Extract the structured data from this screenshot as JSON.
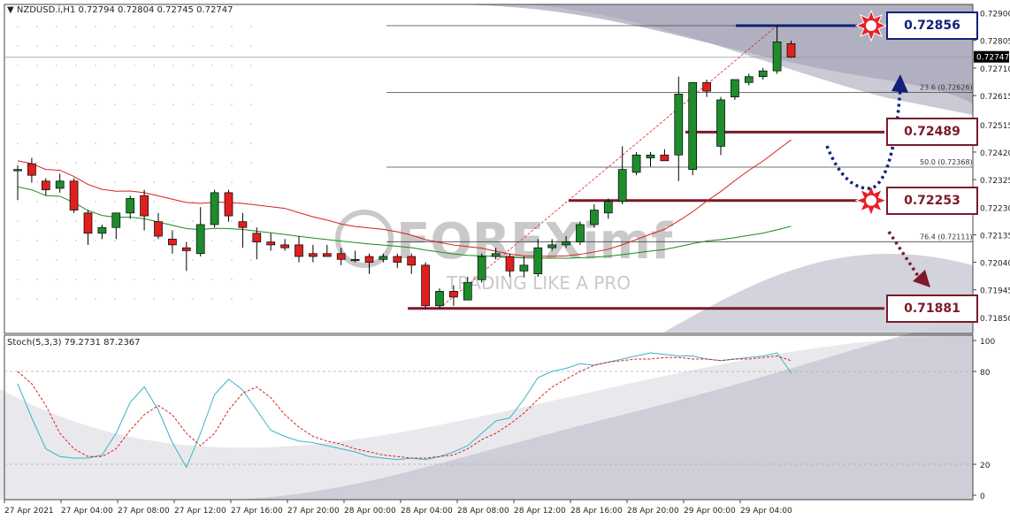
{
  "header": {
    "symbol_text": "NZDUSD.i,H1  0.72794 0.72804 0.72745 0.72747"
  },
  "indicator": {
    "label": "Stoch(5,3,3) 79.2731 87.2367"
  },
  "watermark": {
    "brand": "FOREXimf",
    "tagline": "TRADING LIKE A PRO"
  },
  "colors": {
    "bull": "#1e8c2c",
    "bear": "#e01f1f",
    "ma_fast": "#d62020",
    "ma_slow": "#1a8a1a",
    "stoch_main": "#3bb3c6",
    "stoch_signal": "#d62020",
    "level_high": "#12207a",
    "level_mid": "#7b1a2a"
  },
  "chart_data": {
    "type": "candlestick",
    "symbol": "NZDUSD.i",
    "timeframe": "H1",
    "ylim": [
      0.7181,
      0.7292
    ],
    "y_ticks": [
      "0.72900",
      "0.72805",
      "0.72710",
      "0.72615",
      "0.72515",
      "0.72420",
      "0.72325",
      "0.72230",
      "0.72135",
      "0.72040",
      "0.71945",
      "0.71850"
    ],
    "current_price": "0.72747",
    "x_labels": [
      "27 Apr 2021",
      "27 Apr 04:00",
      "27 Apr 08:00",
      "27 Apr 12:00",
      "27 Apr 16:00",
      "27 Apr 20:00",
      "28 Apr 00:00",
      "28 Apr 04:00",
      "28 Apr 08:00",
      "28 Apr 12:00",
      "28 Apr 16:00",
      "28 Apr 20:00",
      "29 Apr 00:00",
      "29 Apr 04:00"
    ],
    "candles": [
      {
        "o": 0.7236,
        "h": 0.72375,
        "l": 0.72255,
        "c": 0.7236
      },
      {
        "o": 0.7238,
        "h": 0.724,
        "l": 0.72315,
        "c": 0.7234
      },
      {
        "o": 0.7232,
        "h": 0.7233,
        "l": 0.7227,
        "c": 0.7229
      },
      {
        "o": 0.72295,
        "h": 0.72345,
        "l": 0.7228,
        "c": 0.7232
      },
      {
        "o": 0.7232,
        "h": 0.7233,
        "l": 0.7221,
        "c": 0.7222
      },
      {
        "o": 0.7221,
        "h": 0.7222,
        "l": 0.721,
        "c": 0.7214
      },
      {
        "o": 0.7214,
        "h": 0.7217,
        "l": 0.7212,
        "c": 0.7216
      },
      {
        "o": 0.7216,
        "h": 0.7221,
        "l": 0.7212,
        "c": 0.7221
      },
      {
        "o": 0.7221,
        "h": 0.7227,
        "l": 0.7219,
        "c": 0.7226
      },
      {
        "o": 0.7227,
        "h": 0.7229,
        "l": 0.7215,
        "c": 0.722
      },
      {
        "o": 0.7218,
        "h": 0.7221,
        "l": 0.7212,
        "c": 0.7213
      },
      {
        "o": 0.7212,
        "h": 0.7215,
        "l": 0.7207,
        "c": 0.721
      },
      {
        "o": 0.7209,
        "h": 0.7211,
        "l": 0.7201,
        "c": 0.7208
      },
      {
        "o": 0.7207,
        "h": 0.7223,
        "l": 0.7206,
        "c": 0.7217
      },
      {
        "o": 0.7217,
        "h": 0.7229,
        "l": 0.7216,
        "c": 0.7228
      },
      {
        "o": 0.7228,
        "h": 0.7229,
        "l": 0.7218,
        "c": 0.722
      },
      {
        "o": 0.7218,
        "h": 0.7221,
        "l": 0.7209,
        "c": 0.7216
      },
      {
        "o": 0.7214,
        "h": 0.7216,
        "l": 0.7205,
        "c": 0.7211
      },
      {
        "o": 0.7211,
        "h": 0.7214,
        "l": 0.7208,
        "c": 0.721
      },
      {
        "o": 0.721,
        "h": 0.7212,
        "l": 0.7208,
        "c": 0.7209
      },
      {
        "o": 0.721,
        "h": 0.7213,
        "l": 0.7204,
        "c": 0.7206
      },
      {
        "o": 0.7207,
        "h": 0.721,
        "l": 0.7204,
        "c": 0.7206
      },
      {
        "o": 0.7207,
        "h": 0.721,
        "l": 0.7206,
        "c": 0.7206
      },
      {
        "o": 0.7207,
        "h": 0.7209,
        "l": 0.7203,
        "c": 0.7205
      },
      {
        "o": 0.7205,
        "h": 0.7208,
        "l": 0.7204,
        "c": 0.7205
      },
      {
        "o": 0.7206,
        "h": 0.7207,
        "l": 0.72,
        "c": 0.7204
      },
      {
        "o": 0.7205,
        "h": 0.7207,
        "l": 0.7204,
        "c": 0.7206
      },
      {
        "o": 0.7206,
        "h": 0.7207,
        "l": 0.7202,
        "c": 0.7204
      },
      {
        "o": 0.7206,
        "h": 0.7207,
        "l": 0.72,
        "c": 0.7203
      },
      {
        "o": 0.7203,
        "h": 0.7204,
        "l": 0.7188,
        "c": 0.7189
      },
      {
        "o": 0.7189,
        "h": 0.7195,
        "l": 0.7188,
        "c": 0.7194
      },
      {
        "o": 0.7194,
        "h": 0.7196,
        "l": 0.7189,
        "c": 0.7192
      },
      {
        "o": 0.7191,
        "h": 0.7199,
        "l": 0.7191,
        "c": 0.7197
      },
      {
        "o": 0.7198,
        "h": 0.7207,
        "l": 0.7197,
        "c": 0.7206
      },
      {
        "o": 0.7206,
        "h": 0.7209,
        "l": 0.7205,
        "c": 0.7207
      },
      {
        "o": 0.7206,
        "h": 0.7207,
        "l": 0.7199,
        "c": 0.7201
      },
      {
        "o": 0.7201,
        "h": 0.7206,
        "l": 0.7199,
        "c": 0.7203
      },
      {
        "o": 0.72,
        "h": 0.7212,
        "l": 0.7199,
        "c": 0.7209
      },
      {
        "o": 0.7209,
        "h": 0.7212,
        "l": 0.7208,
        "c": 0.721
      },
      {
        "o": 0.721,
        "h": 0.7213,
        "l": 0.7209,
        "c": 0.7211
      },
      {
        "o": 0.7211,
        "h": 0.7218,
        "l": 0.721,
        "c": 0.7217
      },
      {
        "o": 0.7217,
        "h": 0.7224,
        "l": 0.7216,
        "c": 0.7222
      },
      {
        "o": 0.7221,
        "h": 0.7226,
        "l": 0.7219,
        "c": 0.7225
      },
      {
        "o": 0.7225,
        "h": 0.7244,
        "l": 0.7224,
        "c": 0.7236
      },
      {
        "o": 0.7235,
        "h": 0.7242,
        "l": 0.7234,
        "c": 0.7241
      },
      {
        "o": 0.724,
        "h": 0.7242,
        "l": 0.7237,
        "c": 0.7241
      },
      {
        "o": 0.7241,
        "h": 0.7243,
        "l": 0.7239,
        "c": 0.7239
      },
      {
        "o": 0.7241,
        "h": 0.7268,
        "l": 0.7232,
        "c": 0.7262
      },
      {
        "o": 0.7236,
        "h": 0.7266,
        "l": 0.7234,
        "c": 0.7266
      },
      {
        "o": 0.7266,
        "h": 0.7267,
        "l": 0.7261,
        "c": 0.7263
      },
      {
        "o": 0.7244,
        "h": 0.7261,
        "l": 0.7241,
        "c": 0.726
      },
      {
        "o": 0.7261,
        "h": 0.7267,
        "l": 0.726,
        "c": 0.7267
      },
      {
        "o": 0.7266,
        "h": 0.7269,
        "l": 0.7265,
        "c": 0.7268
      },
      {
        "o": 0.7268,
        "h": 0.7271,
        "l": 0.7267,
        "c": 0.727
      },
      {
        "o": 0.727,
        "h": 0.72856,
        "l": 0.7269,
        "c": 0.728
      },
      {
        "o": 0.72794,
        "h": 0.72804,
        "l": 0.72745,
        "c": 0.72747
      }
    ],
    "fibonacci": [
      {
        "label": "23.6 (0.72626)",
        "price": 0.72626
      },
      {
        "label": "50.0 (0.72368)",
        "price": 0.72368
      },
      {
        "label": "76.4 (0.72111)",
        "price": 0.72111
      }
    ],
    "key_levels": [
      {
        "label": "0.72856",
        "price": 0.72856,
        "kind": "high"
      },
      {
        "label": "0.72489",
        "price": 0.72489,
        "kind": "mid"
      },
      {
        "label": "0.72253",
        "price": 0.72253,
        "kind": "mid"
      },
      {
        "label": "0.71881",
        "price": 0.71881,
        "kind": "mid"
      }
    ],
    "stochastic": {
      "name": "Stoch(5,3,3)",
      "main": 79.2731,
      "signal": 87.2367,
      "ylim": [
        0,
        100
      ],
      "y_ticks": [
        "100",
        "80",
        "20",
        "0"
      ],
      "main_values": [
        72,
        50,
        30,
        25,
        24,
        24,
        26,
        40,
        60,
        70,
        55,
        34,
        18,
        40,
        65,
        75,
        68,
        55,
        42,
        38,
        35,
        34,
        32,
        30,
        28,
        25,
        24,
        23,
        24,
        23,
        25,
        28,
        32,
        40,
        48,
        50,
        62,
        76,
        80,
        82,
        85,
        84,
        86,
        88,
        90,
        92,
        91,
        90,
        90,
        88,
        87,
        88,
        89,
        90,
        92,
        79
      ],
      "signal_values": [
        80,
        72,
        58,
        40,
        30,
        25,
        25,
        30,
        42,
        52,
        58,
        52,
        40,
        32,
        40,
        55,
        66,
        70,
        63,
        52,
        44,
        38,
        35,
        33,
        30,
        28,
        26,
        25,
        24,
        24,
        25,
        26,
        30,
        36,
        40,
        46,
        53,
        62,
        70,
        75,
        80,
        84,
        86,
        87,
        88,
        88,
        89,
        89,
        88,
        88,
        87,
        88,
        88,
        89,
        90,
        87
      ]
    }
  }
}
